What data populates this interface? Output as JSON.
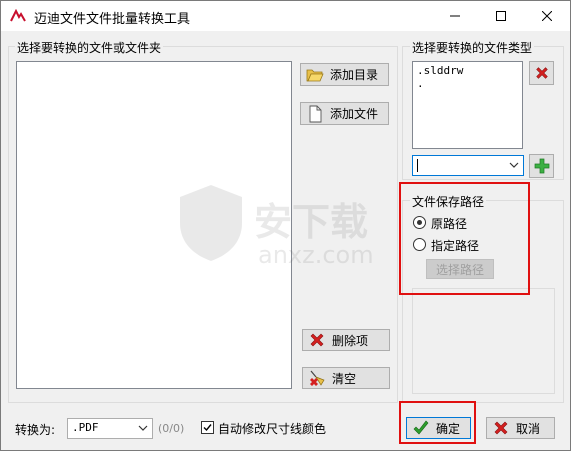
{
  "window": {
    "title": "迈迪文件文件批量转换工具"
  },
  "titlebar_buttons": {
    "minimize": "—",
    "maximize": "☐",
    "close": "✕"
  },
  "left_group": {
    "label": "选择要转换的文件或文件夹"
  },
  "buttons": {
    "add_folder": "添加目录",
    "add_file": "添加文件",
    "delete_item": "删除项",
    "clear": "清空",
    "choose_path": "选择路径",
    "ok": "确定",
    "cancel": "取消"
  },
  "file_type_group": {
    "label": "选择要转换的文件类型",
    "items": [
      ".slddrw",
      "."
    ],
    "combo_value": ""
  },
  "save_path_group": {
    "label": "文件保存路径",
    "options": [
      {
        "label": "原路径",
        "selected": true
      },
      {
        "label": "指定路径",
        "selected": false
      }
    ]
  },
  "convert": {
    "label": "转换为:",
    "value": ".PDF",
    "count": "(0/0)",
    "checkbox_label": "自动修改尺寸线颜色",
    "checkbox_checked": true
  },
  "watermark": {
    "text": "安下载",
    "subtext": "anxz.com"
  },
  "colors": {
    "highlight_border": "#e01010",
    "accent_green": "#2e9e2e",
    "accent_red": "#d42020"
  }
}
